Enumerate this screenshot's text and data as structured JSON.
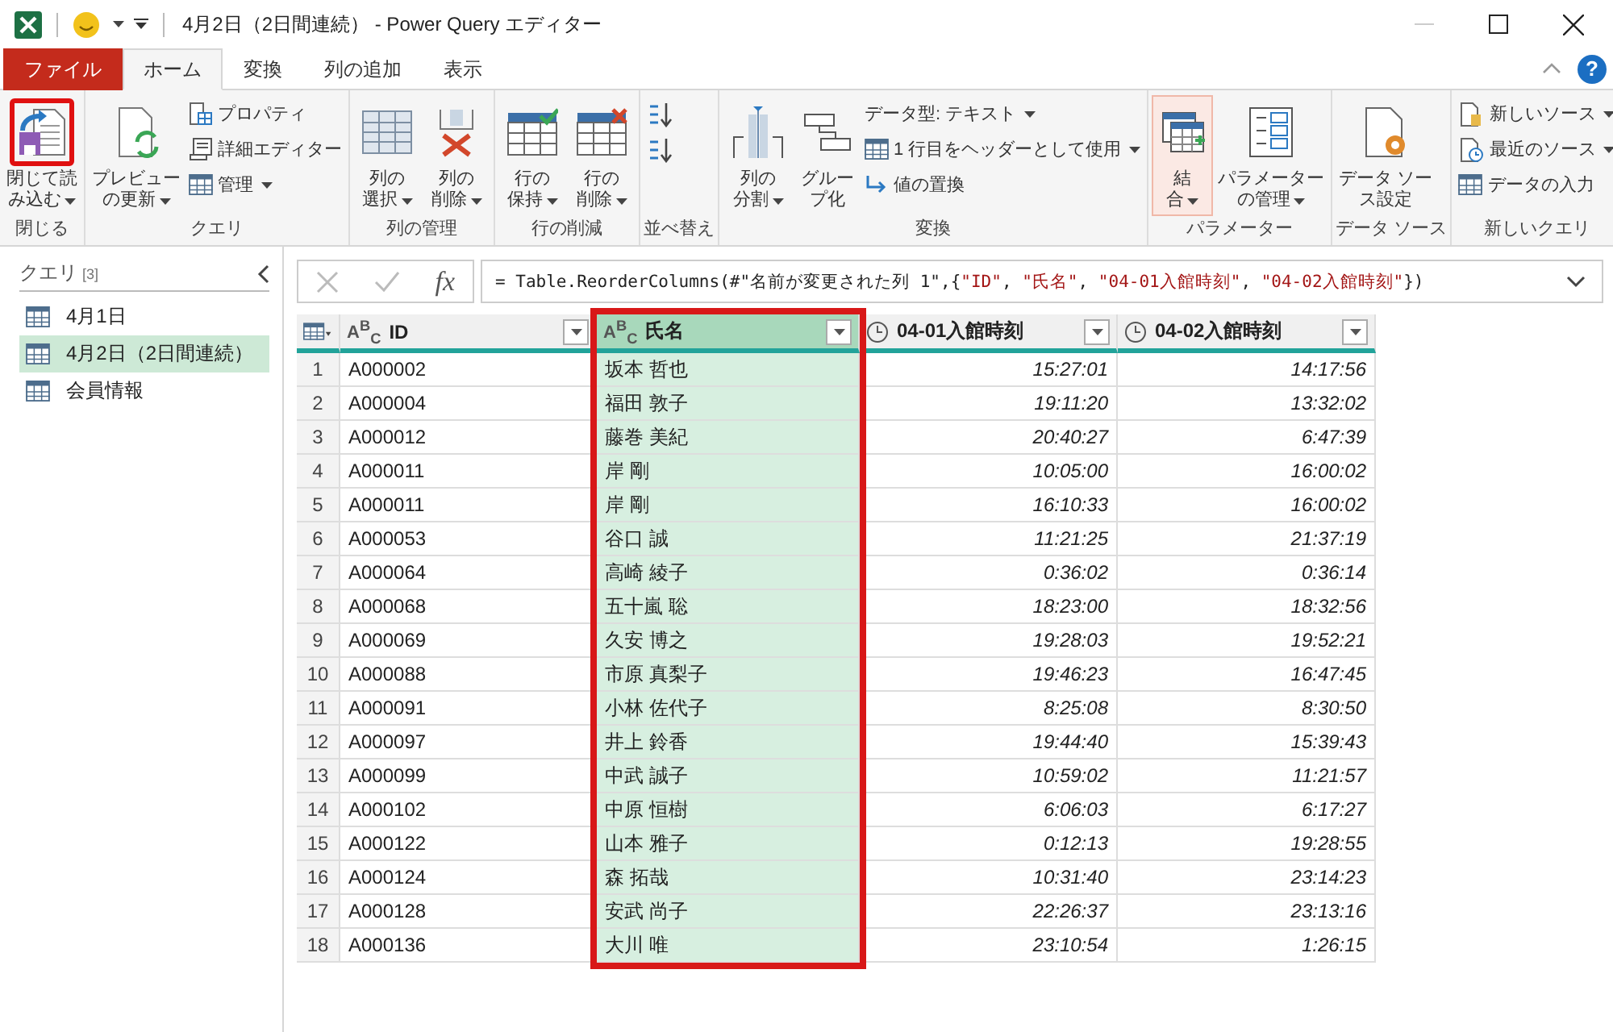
{
  "window": {
    "title": "4月2日（2日間連続） - Power Query エディター"
  },
  "ribbon_tabs": [
    {
      "label": "ファイル",
      "kind": "file",
      "selected": false
    },
    {
      "label": "ホーム",
      "kind": "tab",
      "selected": true
    },
    {
      "label": "変換",
      "kind": "tab",
      "selected": false
    },
    {
      "label": "列の追加",
      "kind": "tab",
      "selected": false
    },
    {
      "label": "表示",
      "kind": "tab",
      "selected": false
    }
  ],
  "help": {
    "label": "?"
  },
  "ribbon_groups": [
    {
      "label": "閉じる",
      "items": [
        {
          "kind": "large",
          "lines": [
            "閉じて読",
            "み込む"
          ],
          "dropdown": true,
          "annotated": true,
          "highlighted": false
        }
      ]
    },
    {
      "label": "クエリ",
      "items": [
        {
          "kind": "large",
          "lines": [
            "プレビュー",
            "の更新"
          ],
          "dropdown": true,
          "annotated": false,
          "highlighted": false
        },
        {
          "kind": "stack",
          "items": [
            {
              "label": "プロパティ",
              "dropdown": false
            },
            {
              "label": "詳細エディター",
              "dropdown": false
            },
            {
              "label": "管理",
              "dropdown": true
            }
          ]
        }
      ]
    },
    {
      "label": "列の管理",
      "items": [
        {
          "kind": "large",
          "lines": [
            "列の",
            "選択"
          ],
          "dropdown": true,
          "annotated": false,
          "highlighted": false
        },
        {
          "kind": "large",
          "lines": [
            "列の",
            "削除"
          ],
          "dropdown": true,
          "annotated": false,
          "highlighted": false
        }
      ]
    },
    {
      "label": "行の削減",
      "items": [
        {
          "kind": "large",
          "lines": [
            "行の",
            "保持"
          ],
          "dropdown": true,
          "annotated": false,
          "highlighted": false
        },
        {
          "kind": "large",
          "lines": [
            "行の",
            "削除"
          ],
          "dropdown": true,
          "annotated": false,
          "highlighted": false
        }
      ]
    },
    {
      "label": "並べ替え",
      "items": [
        {
          "kind": "icons"
        }
      ]
    },
    {
      "label": "変換",
      "items": [
        {
          "kind": "large",
          "lines": [
            "列の",
            "分割"
          ],
          "dropdown": true,
          "annotated": false,
          "highlighted": false
        },
        {
          "kind": "large",
          "lines": [
            "グルー",
            "プ化"
          ],
          "dropdown": false,
          "annotated": false,
          "highlighted": false
        },
        {
          "kind": "stack",
          "items": [
            {
              "label": "データ型: テキスト",
              "dropdown": true
            },
            {
              "label": "1 行目をヘッダーとして使用",
              "dropdown": true
            },
            {
              "label": "値の置換",
              "dropdown": false
            }
          ]
        }
      ]
    },
    {
      "label": "パラメーター",
      "items": [
        {
          "kind": "large",
          "lines": [
            "結",
            "合"
          ],
          "dropdown": true,
          "annotated": false,
          "highlighted": true
        },
        {
          "kind": "large",
          "lines": [
            "パラメーター",
            "の管理"
          ],
          "dropdown": true,
          "annotated": false,
          "highlighted": false
        }
      ]
    },
    {
      "label": "データ ソース",
      "items": [
        {
          "kind": "large",
          "lines": [
            "データ ソー",
            "ス設定"
          ],
          "dropdown": false,
          "annotated": false,
          "highlighted": false
        }
      ]
    },
    {
      "label": "新しいクエリ",
      "items": [
        {
          "kind": "stack",
          "items": [
            {
              "label": "新しいソース",
              "dropdown": true
            },
            {
              "label": "最近のソース",
              "dropdown": true
            },
            {
              "label": "データの入力",
              "dropdown": false
            }
          ]
        }
      ]
    }
  ],
  "sidebar": {
    "title": "クエリ",
    "count": "[3]",
    "items": [
      {
        "label": "4月1日",
        "selected": false
      },
      {
        "label": "4月2日（2日間連続）",
        "selected": true
      },
      {
        "label": "会員情報",
        "selected": false
      }
    ]
  },
  "formula_bar": {
    "fx_label": "fx",
    "tokens": [
      {
        "text": "= Table.ReorderColumns(#\"名前が変更された列 1\",{",
        "kind": "code"
      },
      {
        "text": "\"ID\"",
        "kind": "string"
      },
      {
        "text": ", ",
        "kind": "code"
      },
      {
        "text": "\"氏名\"",
        "kind": "string"
      },
      {
        "text": ", ",
        "kind": "code"
      },
      {
        "text": "\"04-01入館時刻\"",
        "kind": "string"
      },
      {
        "text": ", ",
        "kind": "code"
      },
      {
        "text": "\"04-02入館時刻\"",
        "kind": "string"
      },
      {
        "text": "})",
        "kind": "code"
      }
    ]
  },
  "table": {
    "columns": [
      {
        "name": "ID",
        "kind": "text",
        "type_label": "A$^{B}$$_{C}$",
        "selected": false,
        "annotated": false
      },
      {
        "name": "氏名",
        "kind": "text",
        "type_label": "A$^{B}$$_{C}$",
        "selected": true,
        "annotated": true
      },
      {
        "name": "04-01入館時刻",
        "kind": "time",
        "selected": false,
        "annotated": false
      },
      {
        "name": "04-02入館時刻",
        "kind": "time",
        "selected": false,
        "annotated": false
      }
    ],
    "rows": [
      {
        "index": "1",
        "cells": [
          "A000002",
          "坂本 哲也",
          "15:27:01",
          "14:17:56"
        ]
      },
      {
        "index": "2",
        "cells": [
          "A000004",
          "福田 敦子",
          "19:11:20",
          "13:32:02"
        ]
      },
      {
        "index": "3",
        "cells": [
          "A000012",
          "藤巻 美紀",
          "20:40:27",
          "6:47:39"
        ]
      },
      {
        "index": "4",
        "cells": [
          "A000011",
          "岸 剛",
          "10:05:00",
          "16:00:02"
        ]
      },
      {
        "index": "5",
        "cells": [
          "A000011",
          "岸 剛",
          "16:10:33",
          "16:00:02"
        ]
      },
      {
        "index": "6",
        "cells": [
          "A000053",
          "谷口 誠",
          "11:21:25",
          "21:37:19"
        ]
      },
      {
        "index": "7",
        "cells": [
          "A000064",
          "高崎 綾子",
          "0:36:02",
          "0:36:14"
        ]
      },
      {
        "index": "8",
        "cells": [
          "A000068",
          "五十嵐 聡",
          "18:23:00",
          "18:32:56"
        ]
      },
      {
        "index": "9",
        "cells": [
          "A000069",
          "久安 博之",
          "19:28:03",
          "19:52:21"
        ]
      },
      {
        "index": "10",
        "cells": [
          "A000088",
          "市原 真梨子",
          "19:46:23",
          "16:47:45"
        ]
      },
      {
        "index": "11",
        "cells": [
          "A000091",
          "小林 佐代子",
          "8:25:08",
          "8:30:50"
        ]
      },
      {
        "index": "12",
        "cells": [
          "A000097",
          "井上 鈴香",
          "19:44:40",
          "15:39:43"
        ]
      },
      {
        "index": "13",
        "cells": [
          "A000099",
          "中武 誠子",
          "10:59:02",
          "11:21:57"
        ]
      },
      {
        "index": "14",
        "cells": [
          "A000102",
          "中原 恒樹",
          "6:06:03",
          "6:17:27"
        ]
      },
      {
        "index": "15",
        "cells": [
          "A000122",
          "山本 雅子",
          "0:12:13",
          "19:28:55"
        ]
      },
      {
        "index": "16",
        "cells": [
          "A000124",
          "森 拓哉",
          "10:31:40",
          "23:14:23"
        ]
      },
      {
        "index": "17",
        "cells": [
          "A000128",
          "安武 尚子",
          "22:26:37",
          "23:13:16"
        ]
      },
      {
        "index": "18",
        "cells": [
          "A000136",
          "大川 唯",
          "23:10:54",
          "1:26:15"
        ]
      }
    ]
  }
}
